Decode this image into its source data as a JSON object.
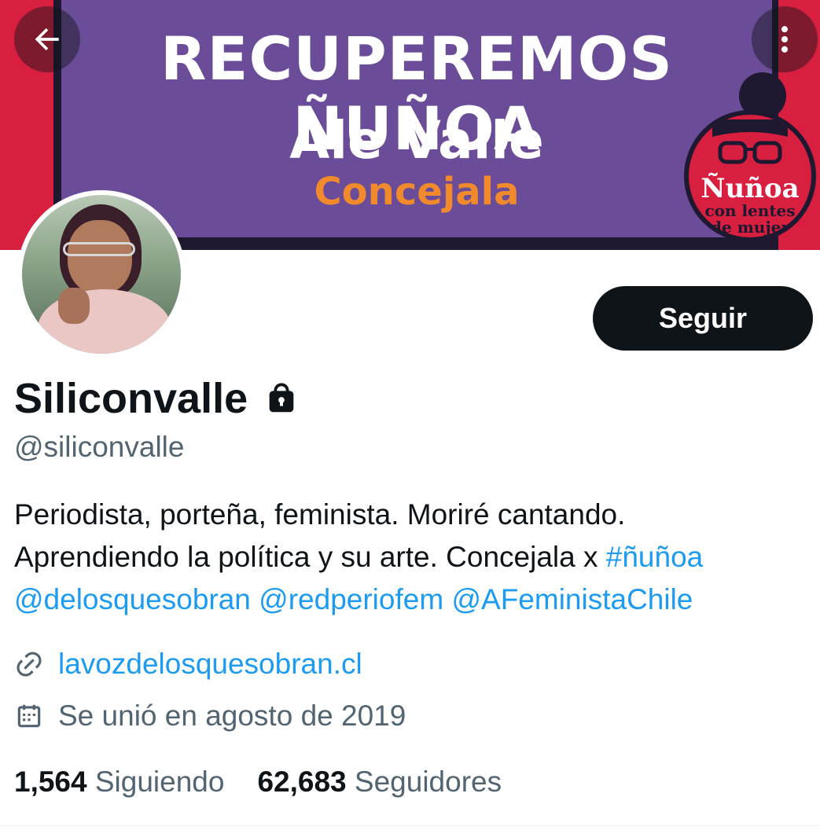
{
  "banner": {
    "title": "RECUPEREMOS ÑUÑOA",
    "name": "Ale Valle",
    "role": "Concejala",
    "badge_title": "Ñuñoa",
    "badge_line2": "con lentes",
    "badge_line3": "de mujer",
    "colors": {
      "purple": "#6a4c98",
      "red": "#d81f3f",
      "orange": "#f08a2c"
    }
  },
  "nav": {
    "back_icon": "arrow-left-icon",
    "more_icon": "more-vertical-icon"
  },
  "profile": {
    "display_name": "Siliconvalle",
    "protected_icon": "lock-icon",
    "handle": "@siliconvalle",
    "follow_label": "Seguir",
    "bio_line1": "Periodista, porteña, feminista. Moriré cantando.",
    "bio_line2_text": "Aprendiendo la política y su arte. Concejala x ",
    "bio_hashtag": "#ñuñoa",
    "bio_mention1": "@delosquesobran",
    "bio_mention2": "@redperiofem",
    "bio_mention3": "@AFeministaChile",
    "url": "lavozdelosquesobran.cl",
    "joined": "Se unió en agosto de 2019",
    "following_count": "1,564",
    "following_label": "Siguiendo",
    "followers_count": "62,683",
    "followers_label": "Seguidores"
  },
  "colors": {
    "link": "#1d9bf0",
    "text": "#0f1419",
    "muted": "#536471",
    "button_bg": "#0f1419"
  }
}
